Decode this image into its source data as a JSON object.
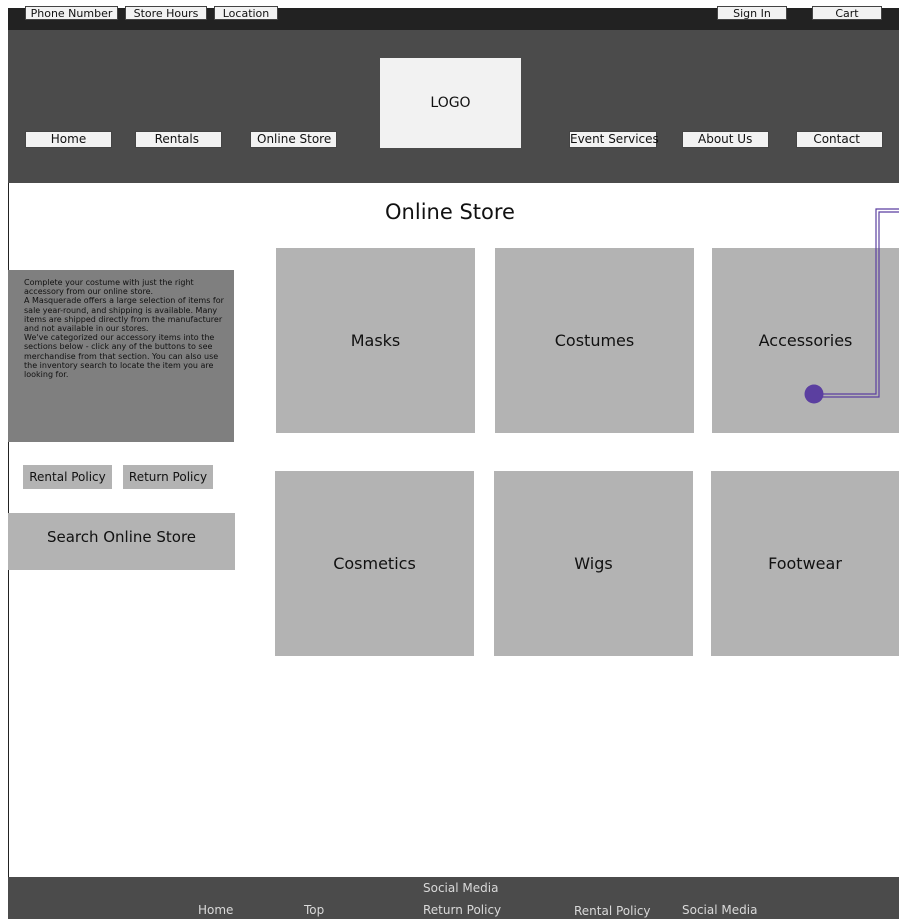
{
  "topbar": {
    "left_items": [
      "Phone Number",
      "Store Hours",
      "Location"
    ],
    "sign_in": "Sign In",
    "cart": "Cart"
  },
  "header": {
    "logo": "LOGO",
    "nav": [
      "Home",
      "Rentals",
      "Online Store",
      "Event Services",
      "About Us",
      "Contact"
    ]
  },
  "main": {
    "title": "Online Store",
    "description": [
      "Complete your costume with just the right accessory from our online store.",
      "A Masquerade offers a large selection of items for sale year-round, and shipping is available. Many items are shipped directly from the manufacturer and not available in our stores.",
      "We've categorized our accessory items into the sections below - click any of the buttons to see merchandise from that section. You can also use the inventory search to locate the item you are looking for."
    ],
    "rental_policy": "Rental Policy",
    "return_policy": "Return Policy",
    "search_label": "Search Online Store",
    "categories": [
      "Masks",
      "Costumes",
      "Accessories",
      "Cosmetics",
      "Wigs",
      "Footwear"
    ]
  },
  "footer": {
    "links": [
      "Social Media",
      "Home",
      "Top",
      "Return Policy",
      "Rental Policy",
      "Social Media"
    ]
  },
  "colors": {
    "topbar": "#222222",
    "header": "#4b4b4b",
    "tile": "#b3b3b3",
    "info_panel": "#7f7f7f",
    "connector": "#5b3fa0"
  }
}
